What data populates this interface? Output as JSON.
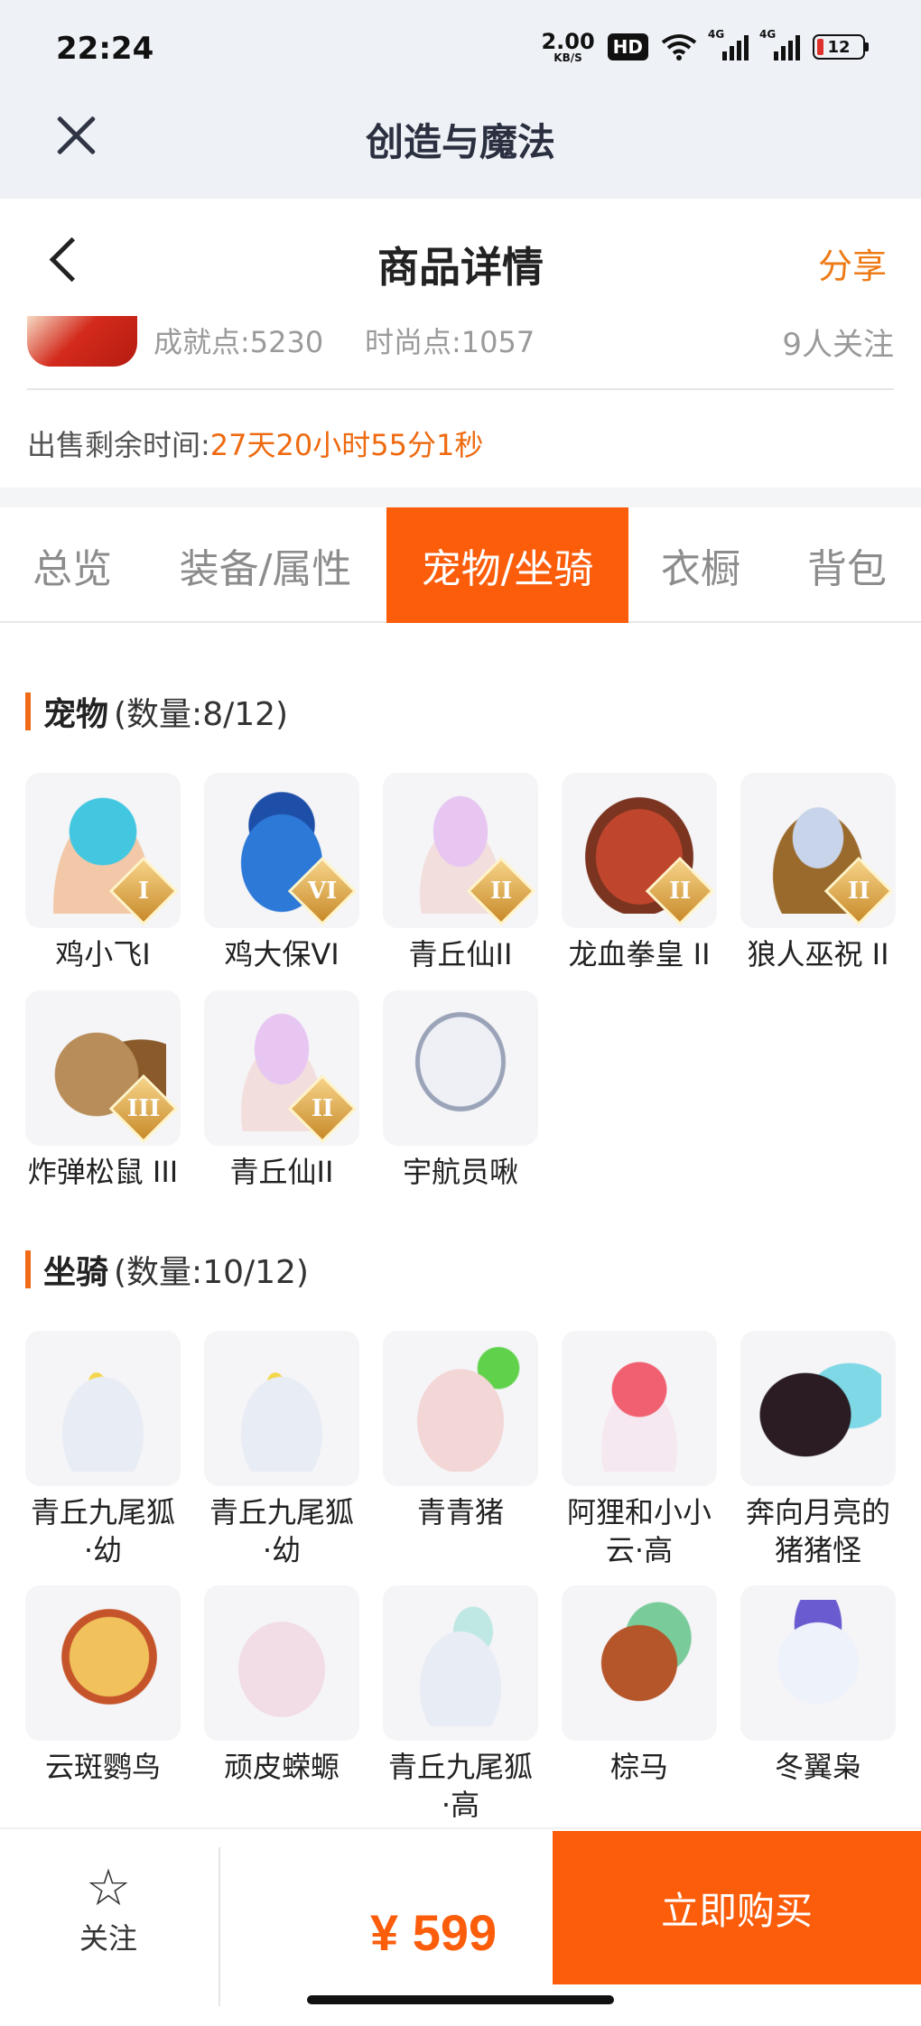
{
  "status_bar": {
    "time": "22:24",
    "net_speed": "2.00",
    "net_unit": "KB/S",
    "hd": "HD",
    "signal1": "4G",
    "signal2": "4G",
    "battery": "12",
    "battery_color": "#e0322c"
  },
  "mini_header": {
    "title": "创造与魔法",
    "close_icon": "close-icon"
  },
  "page_header": {
    "title": "商品详情",
    "share_label": "分享",
    "back_icon": "chevron-left-icon"
  },
  "summary": {
    "achievement": "成就点:5230",
    "fashion": "时尚点:1057",
    "followers": "9人关注",
    "sale_time_label": "出售剩余时间:",
    "sale_time_value": "27天20小时55分1秒"
  },
  "tabs": [
    "总览",
    "装备/属性",
    "宠物/坐骑",
    "衣橱",
    "背包"
  ],
  "active_tab": 2,
  "pets": {
    "title": "宠物",
    "count": "(数量:8/12)",
    "items": [
      {
        "label": "鸡小飞I",
        "grade": "I"
      },
      {
        "label": "鸡大保VI",
        "grade": "VI"
      },
      {
        "label": "青丘仙II",
        "grade": "II"
      },
      {
        "label": "龙血拳皇 II",
        "grade": "II"
      },
      {
        "label": "狼人巫祝 II",
        "grade": "II"
      },
      {
        "label": "炸弹松鼠 III",
        "grade": "III"
      },
      {
        "label": "青丘仙II",
        "grade": "II"
      },
      {
        "label": "宇航员啾",
        "grade": ""
      }
    ]
  },
  "mounts": {
    "title": "坐骑",
    "count": "(数量:10/12)",
    "items": [
      {
        "label1": "青丘九尾狐",
        "label2": "·幼"
      },
      {
        "label1": "青丘九尾狐",
        "label2": "·幼"
      },
      {
        "label1": "青青猪",
        "label2": ""
      },
      {
        "label1": "阿狸和小小",
        "label2": "云·高"
      },
      {
        "label1": "奔向月亮的",
        "label2": "猪猪怪"
      },
      {
        "label1": "云斑鹦鸟",
        "label2": ""
      },
      {
        "label1": "顽皮蝾螈",
        "label2": ""
      },
      {
        "label1": "青丘九尾狐",
        "label2": "·高"
      },
      {
        "label1": "棕马",
        "label2": ""
      },
      {
        "label1": "冬翼枭",
        "label2": ""
      }
    ]
  },
  "bottom_bar": {
    "follow_label": "关注",
    "price": "¥ 599",
    "buy_label": "立即购买",
    "accent": "#fb5d0b"
  }
}
